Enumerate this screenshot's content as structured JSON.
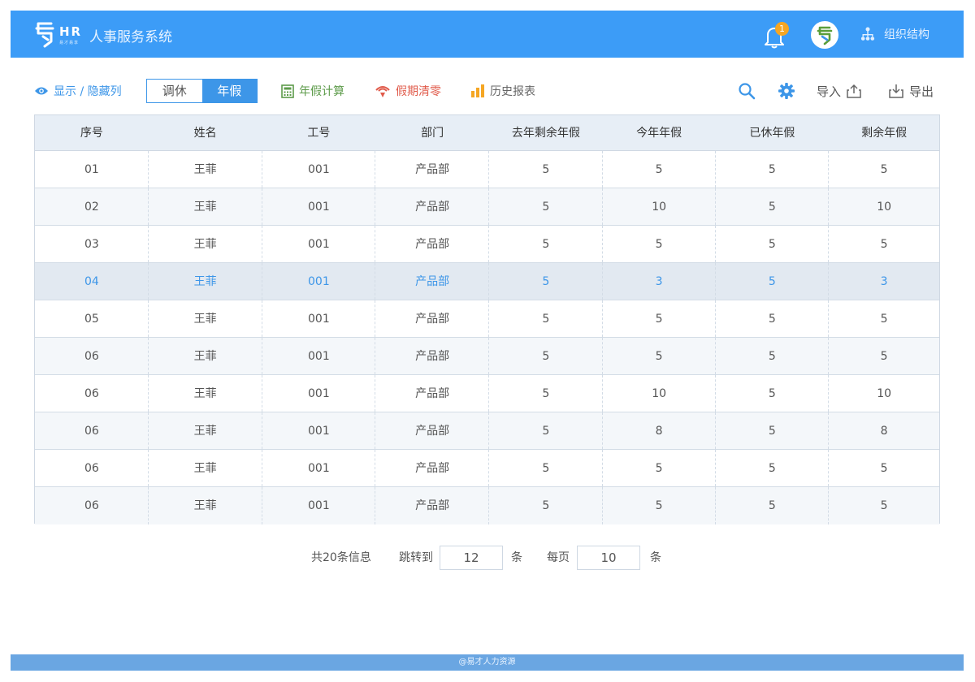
{
  "header": {
    "logo_text": "HR",
    "logo_sub": "易才易享",
    "app_title": "人事服务系统",
    "notification_count": "1",
    "org_label": "组织结构"
  },
  "toolbar": {
    "toggle_columns_label": "显示 / 隐藏列",
    "tabs": [
      {
        "label": "调休",
        "active": false
      },
      {
        "label": "年假",
        "active": true
      }
    ],
    "calc_label": "年假计算",
    "clear_label": "假期清零",
    "history_label": "历史报表",
    "import_label": "导入",
    "export_label": "导出"
  },
  "table": {
    "columns": [
      "序号",
      "姓名",
      "工号",
      "部门",
      "去年剩余年假",
      "今年年假",
      "已休年假",
      "剩余年假"
    ],
    "selected_row": 3,
    "rows": [
      [
        "01",
        "王菲",
        "001",
        "产品部",
        "5",
        "5",
        "5",
        "5"
      ],
      [
        "02",
        "王菲",
        "001",
        "产品部",
        "5",
        "10",
        "5",
        "10"
      ],
      [
        "03",
        "王菲",
        "001",
        "产品部",
        "5",
        "5",
        "5",
        "5"
      ],
      [
        "04",
        "王菲",
        "001",
        "产品部",
        "5",
        "3",
        "5",
        "3"
      ],
      [
        "05",
        "王菲",
        "001",
        "产品部",
        "5",
        "5",
        "5",
        "5"
      ],
      [
        "06",
        "王菲",
        "001",
        "产品部",
        "5",
        "5",
        "5",
        "5"
      ],
      [
        "06",
        "王菲",
        "001",
        "产品部",
        "5",
        "10",
        "5",
        "10"
      ],
      [
        "06",
        "王菲",
        "001",
        "产品部",
        "5",
        "8",
        "5",
        "8"
      ],
      [
        "06",
        "王菲",
        "001",
        "产品部",
        "5",
        "5",
        "5",
        "5"
      ],
      [
        "06",
        "王菲",
        "001",
        "产品部",
        "5",
        "5",
        "5",
        "5"
      ]
    ]
  },
  "pagination": {
    "total_text": "共20条信息",
    "jump_label": "跳转到",
    "jump_value": "12",
    "unit": "条",
    "per_page_label": "每页",
    "per_page_value": "10"
  },
  "footer": {
    "text": "@易才人力资源"
  },
  "colors": {
    "header_bg": "#3c9cf7",
    "accent": "#3d96e8",
    "badge": "#f5a623",
    "footer_bg": "#6aa6e2"
  }
}
